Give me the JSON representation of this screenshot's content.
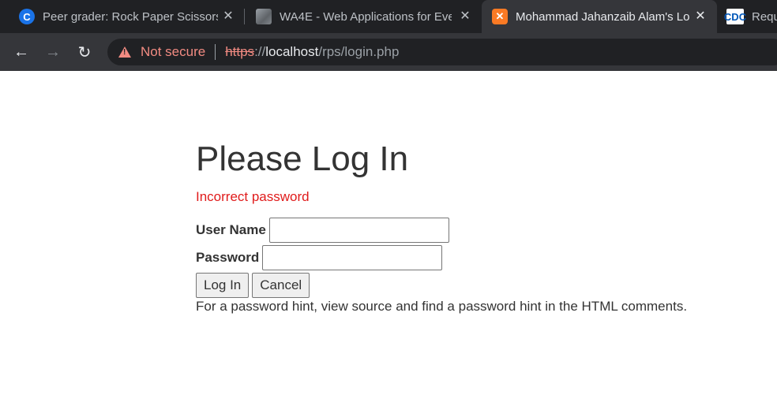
{
  "browser": {
    "tabs": [
      {
        "title": "Peer grader: Rock Paper Scissors |",
        "favicon": "c-logo-icon",
        "favicon_text": "C",
        "active": false
      },
      {
        "title": "WA4E - Web Applications for Eve",
        "favicon": "image-icon",
        "favicon_text": "",
        "active": false
      },
      {
        "title": "Mohammad Jahanzaib Alam's Lo",
        "favicon": "xampp-icon",
        "favicon_text": "✕",
        "active": true
      },
      {
        "title": "Requ",
        "favicon": "cdc-icon",
        "favicon_text": "CDC",
        "active": false
      }
    ],
    "close_glyph": "✕",
    "nav": {
      "back": "←",
      "forward": "→",
      "reload": "↻"
    },
    "omnibox": {
      "security_label": "Not secure",
      "scheme": "https",
      "scheme_sep": "://",
      "host": "localhost",
      "path": "/rps/login.php"
    }
  },
  "page": {
    "heading": "Please Log In",
    "error_message": "Incorrect password",
    "username_label": "User Name",
    "username_value": "",
    "password_label": "Password",
    "password_value": "",
    "login_button": "Log In",
    "cancel_button": "Cancel",
    "hint_text": "For a password hint, view source and find a password hint in the HTML comments."
  },
  "colors": {
    "error": "#e01b1b",
    "not_secure": "#f28b82",
    "tabstrip_bg": "#202124",
    "toolbar_bg": "#35363a"
  }
}
